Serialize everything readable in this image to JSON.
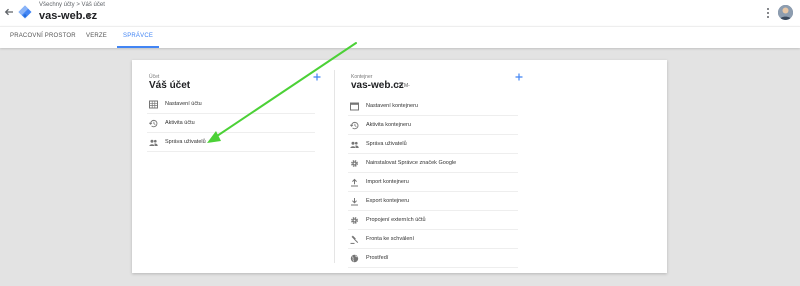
{
  "header": {
    "breadcrumb_root": "Všechny účty",
    "breadcrumb_separator": ">",
    "breadcrumb_account": "Váš účet",
    "container_name": "vas-web.cz"
  },
  "tabs": [
    {
      "label": "PRACOVNÍ PROSTOR"
    },
    {
      "label": "VERZE"
    },
    {
      "label": "SPRÁVCE"
    }
  ],
  "account": {
    "label": "Účet",
    "title": "Váš účet",
    "items": [
      {
        "label": "Nastavení účtu",
        "icon": "table-icon"
      },
      {
        "label": "Aktivita účtu",
        "icon": "history-icon"
      },
      {
        "label": "Správa uživatelů",
        "icon": "people-icon"
      }
    ]
  },
  "container": {
    "label": "Kontejner",
    "title": "vas-web.cz",
    "id_prefix": "GTM-",
    "items": [
      {
        "label": "Nastavení kontejneru",
        "icon": "window-icon"
      },
      {
        "label": "Aktivita kontejneru",
        "icon": "history-icon"
      },
      {
        "label": "Správa uživatelů",
        "icon": "people-icon"
      },
      {
        "label": "Nainstalovat Správce značek Google",
        "icon": "gear-icon"
      },
      {
        "label": "Import kontejneru",
        "icon": "upload-icon"
      },
      {
        "label": "Export kontejneru",
        "icon": "download-icon"
      },
      {
        "label": "Propojení externích účtů",
        "icon": "gear-icon"
      },
      {
        "label": "Fronta ke schválení",
        "icon": "gavel-icon"
      },
      {
        "label": "Prostředí",
        "icon": "globe-icon"
      }
    ]
  },
  "colors": {
    "accent_blue": "#4285f4",
    "annotation_arrow": "#4cd137",
    "background": "#e3e3e3"
  }
}
